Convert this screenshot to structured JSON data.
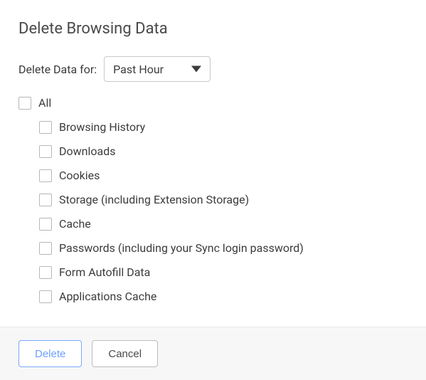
{
  "title": "Delete Browsing Data",
  "range": {
    "label": "Delete Data for:",
    "selected": "Past Hour"
  },
  "all": {
    "label": "All",
    "checked": false
  },
  "items": [
    {
      "label": "Browsing History",
      "checked": false
    },
    {
      "label": "Downloads",
      "checked": false
    },
    {
      "label": "Cookies",
      "checked": false
    },
    {
      "label": "Storage (including Extension Storage)",
      "checked": false
    },
    {
      "label": "Cache",
      "checked": false
    },
    {
      "label": "Passwords (including your Sync login password)",
      "checked": false
    },
    {
      "label": "Form Autofill Data",
      "checked": false
    },
    {
      "label": "Applications Cache",
      "checked": false
    }
  ],
  "buttons": {
    "delete": "Delete",
    "cancel": "Cancel"
  }
}
